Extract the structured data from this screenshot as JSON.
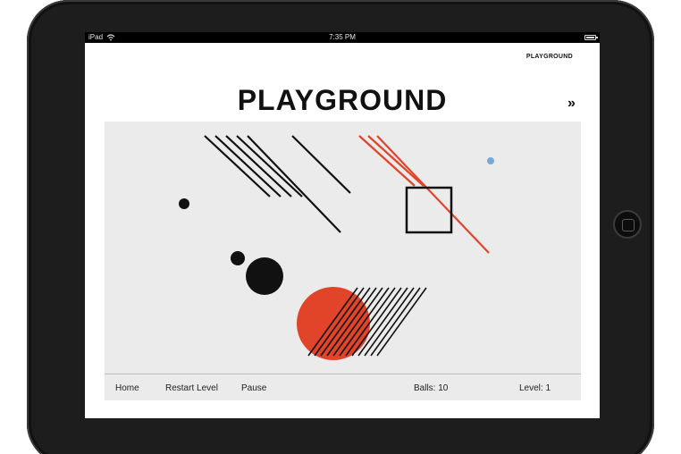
{
  "status_bar": {
    "device": "iPad",
    "time": "7:35 PM"
  },
  "header": {
    "top_label": "PLAYGROUND",
    "title": "PLAYGROUND",
    "next_icon": "»"
  },
  "footer": {
    "home": "Home",
    "restart": "Restart Level",
    "pause": "Pause",
    "balls": "Balls: 10",
    "level": "Level: 1"
  },
  "colors": {
    "accent": "#e2442a",
    "ball": "#7aa9d8",
    "ink": "#111111",
    "canvas": "#ebebeb"
  },
  "icons": [
    "wifi-icon",
    "battery-icon",
    "double-chevron-right-icon",
    "home-button-icon"
  ]
}
